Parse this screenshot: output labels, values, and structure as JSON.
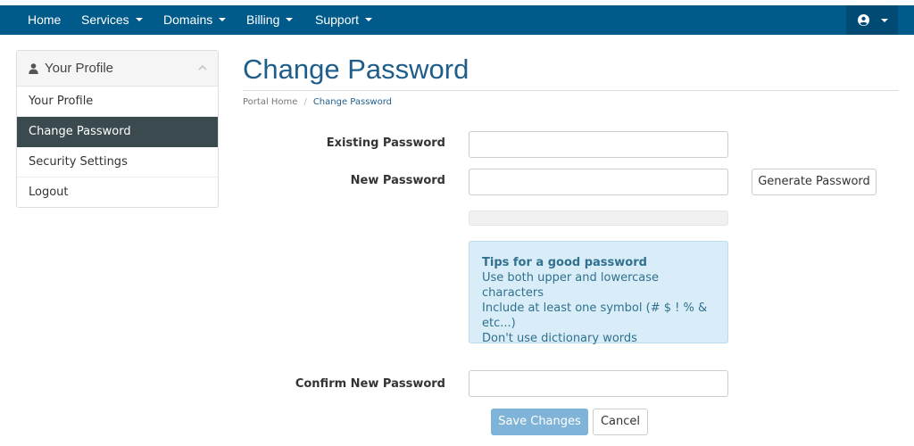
{
  "nav": {
    "items": [
      {
        "label": "Home",
        "dropdown": false
      },
      {
        "label": "Services",
        "dropdown": true
      },
      {
        "label": "Domains",
        "dropdown": true
      },
      {
        "label": "Billing",
        "dropdown": true
      },
      {
        "label": "Support",
        "dropdown": true
      }
    ],
    "account_icon": "user-circle-icon",
    "colors": {
      "bar": "#005b8a",
      "account_bg": "#004a73"
    }
  },
  "sidebar": {
    "header": "Your Profile",
    "header_icon": "user-icon",
    "collapse_icon": "chevron-up-icon",
    "items": [
      {
        "label": "Your Profile",
        "active": false
      },
      {
        "label": "Change Password",
        "active": true
      },
      {
        "label": "Security Settings",
        "active": false
      },
      {
        "label": "Logout",
        "active": false
      }
    ]
  },
  "page": {
    "title": "Change Password",
    "breadcrumb": {
      "home": "Portal Home",
      "separator": "/",
      "current": "Change Password"
    }
  },
  "form": {
    "existing_label": "Existing Password",
    "existing_value": "",
    "new_label": "New Password",
    "new_value": "",
    "generate_button": "Generate Password",
    "tips": {
      "title": "Tips for a good password",
      "lines": [
        "Use both upper and lowercase characters",
        "Include at least one symbol (# $ ! % & etc...)",
        "Don't use dictionary words"
      ]
    },
    "confirm_label": "Confirm New Password",
    "confirm_value": "",
    "save_button": "Save Changes",
    "cancel_button": "Cancel"
  }
}
